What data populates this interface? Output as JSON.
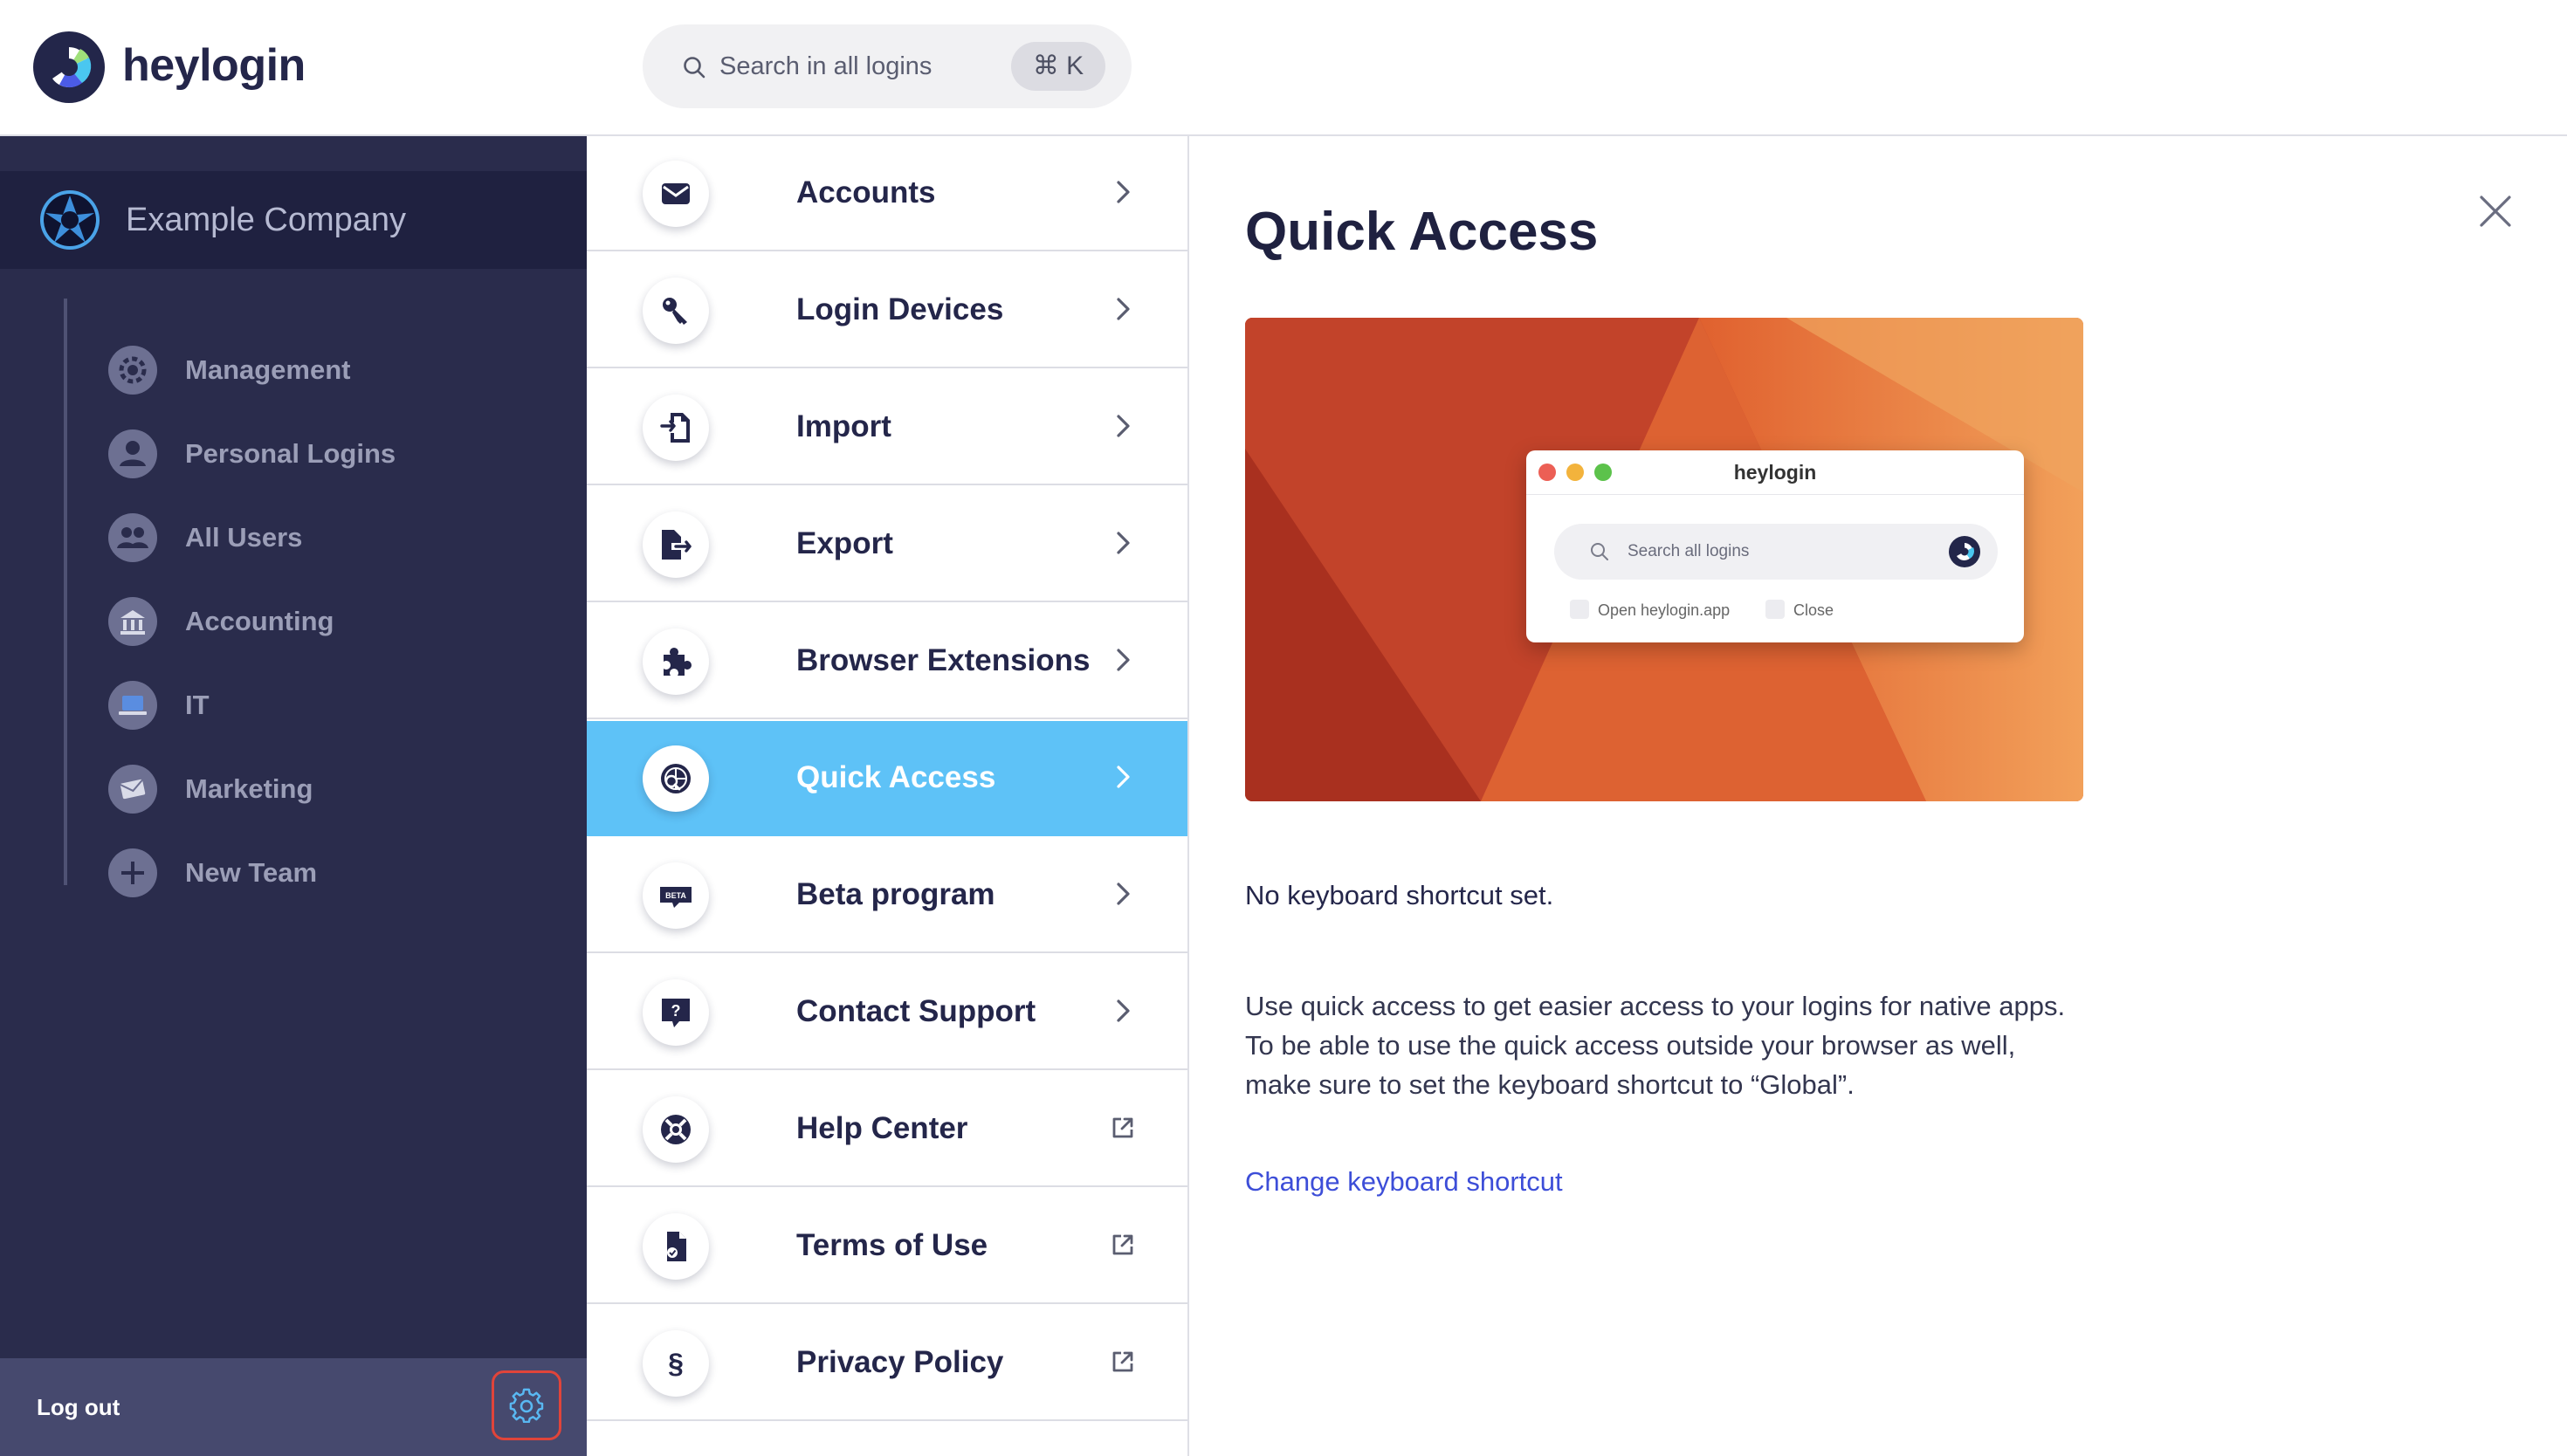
{
  "header": {
    "brand": "heylogin",
    "search_placeholder": "Search in all logins",
    "search_shortcut": "⌘ K"
  },
  "sidebar": {
    "company": "Example Company",
    "teams": [
      {
        "label": "Management",
        "icon": "cog-icon"
      },
      {
        "label": "Personal Logins",
        "icon": "user-icon"
      },
      {
        "label": "All Users",
        "icon": "users-icon"
      },
      {
        "label": "Accounting",
        "icon": "bank-icon"
      },
      {
        "label": "IT",
        "icon": "laptop-icon"
      },
      {
        "label": "Marketing",
        "icon": "envelope-icon"
      },
      {
        "label": "New Team",
        "icon": "plus-icon"
      }
    ],
    "logout": "Log out"
  },
  "menu": {
    "items": [
      {
        "label": "Accounts",
        "icon": "envelope-icon",
        "end": "chevron"
      },
      {
        "label": "Login Devices",
        "icon": "key-icon",
        "end": "chevron"
      },
      {
        "label": "Import",
        "icon": "import-icon",
        "end": "chevron"
      },
      {
        "label": "Export",
        "icon": "export-icon",
        "end": "chevron"
      },
      {
        "label": "Browser Extensions",
        "icon": "puzzle-icon",
        "end": "chevron"
      },
      {
        "label": "Quick Access",
        "icon": "quick-access-icon",
        "end": "chevron",
        "active": true
      },
      {
        "label": "Beta program",
        "icon": "beta-icon",
        "badge": "BETA",
        "end": "chevron"
      },
      {
        "label": "Contact Support",
        "icon": "question-icon",
        "end": "chevron"
      },
      {
        "label": "Help Center",
        "icon": "lifebuoy-icon",
        "end": "external"
      },
      {
        "label": "Terms of Use",
        "icon": "document-icon",
        "end": "external"
      },
      {
        "label": "Privacy Policy",
        "icon": "paragraph-icon",
        "glyph": "§",
        "end": "external"
      }
    ]
  },
  "detail": {
    "title": "Quick Access",
    "preview": {
      "window_title": "heylogin",
      "search_placeholder": "Search all logins",
      "hint_open": "Open heylogin.app",
      "hint_close": "Close"
    },
    "status": "No keyboard shortcut set.",
    "description": "Use quick access to get easier access to your logins for native apps. To be able to use the quick access outside your browser as well, make sure to set the keyboard shortcut to “Global”.",
    "link": "Change keyboard shortcut"
  },
  "colors": {
    "sidebar_bg": "#2a2c4c",
    "company_bg": "#1f2140",
    "footer_bg": "#46496e",
    "active_item": "#5ec2f7",
    "link": "#3d4ed8",
    "highlight": "#e0443a"
  }
}
